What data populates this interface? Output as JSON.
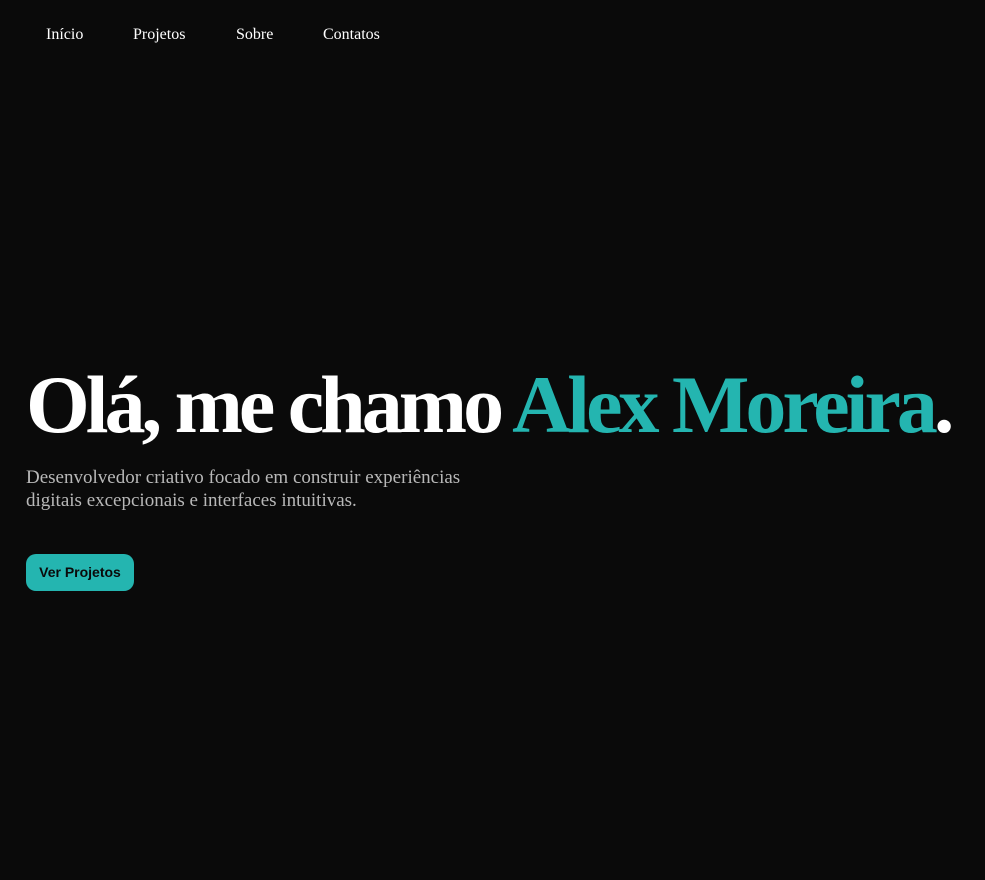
{
  "nav": {
    "items": [
      {
        "label": "Início"
      },
      {
        "label": "Projetos"
      },
      {
        "label": "Sobre"
      },
      {
        "label": "Contatos"
      }
    ]
  },
  "hero": {
    "greeting": "Olá, me chamo ",
    "name": "Alex Moreira",
    "punctuation": ".",
    "description": "Desenvolvedor criativo focado em construir experiências digitais excepcionais e interfaces intuitivas.",
    "cta_label": "Ver Projetos"
  },
  "colors": {
    "background": "#0a0a0a",
    "accent": "#24b5b0",
    "text": "#ffffff",
    "muted_text": "#b8b8b8"
  }
}
